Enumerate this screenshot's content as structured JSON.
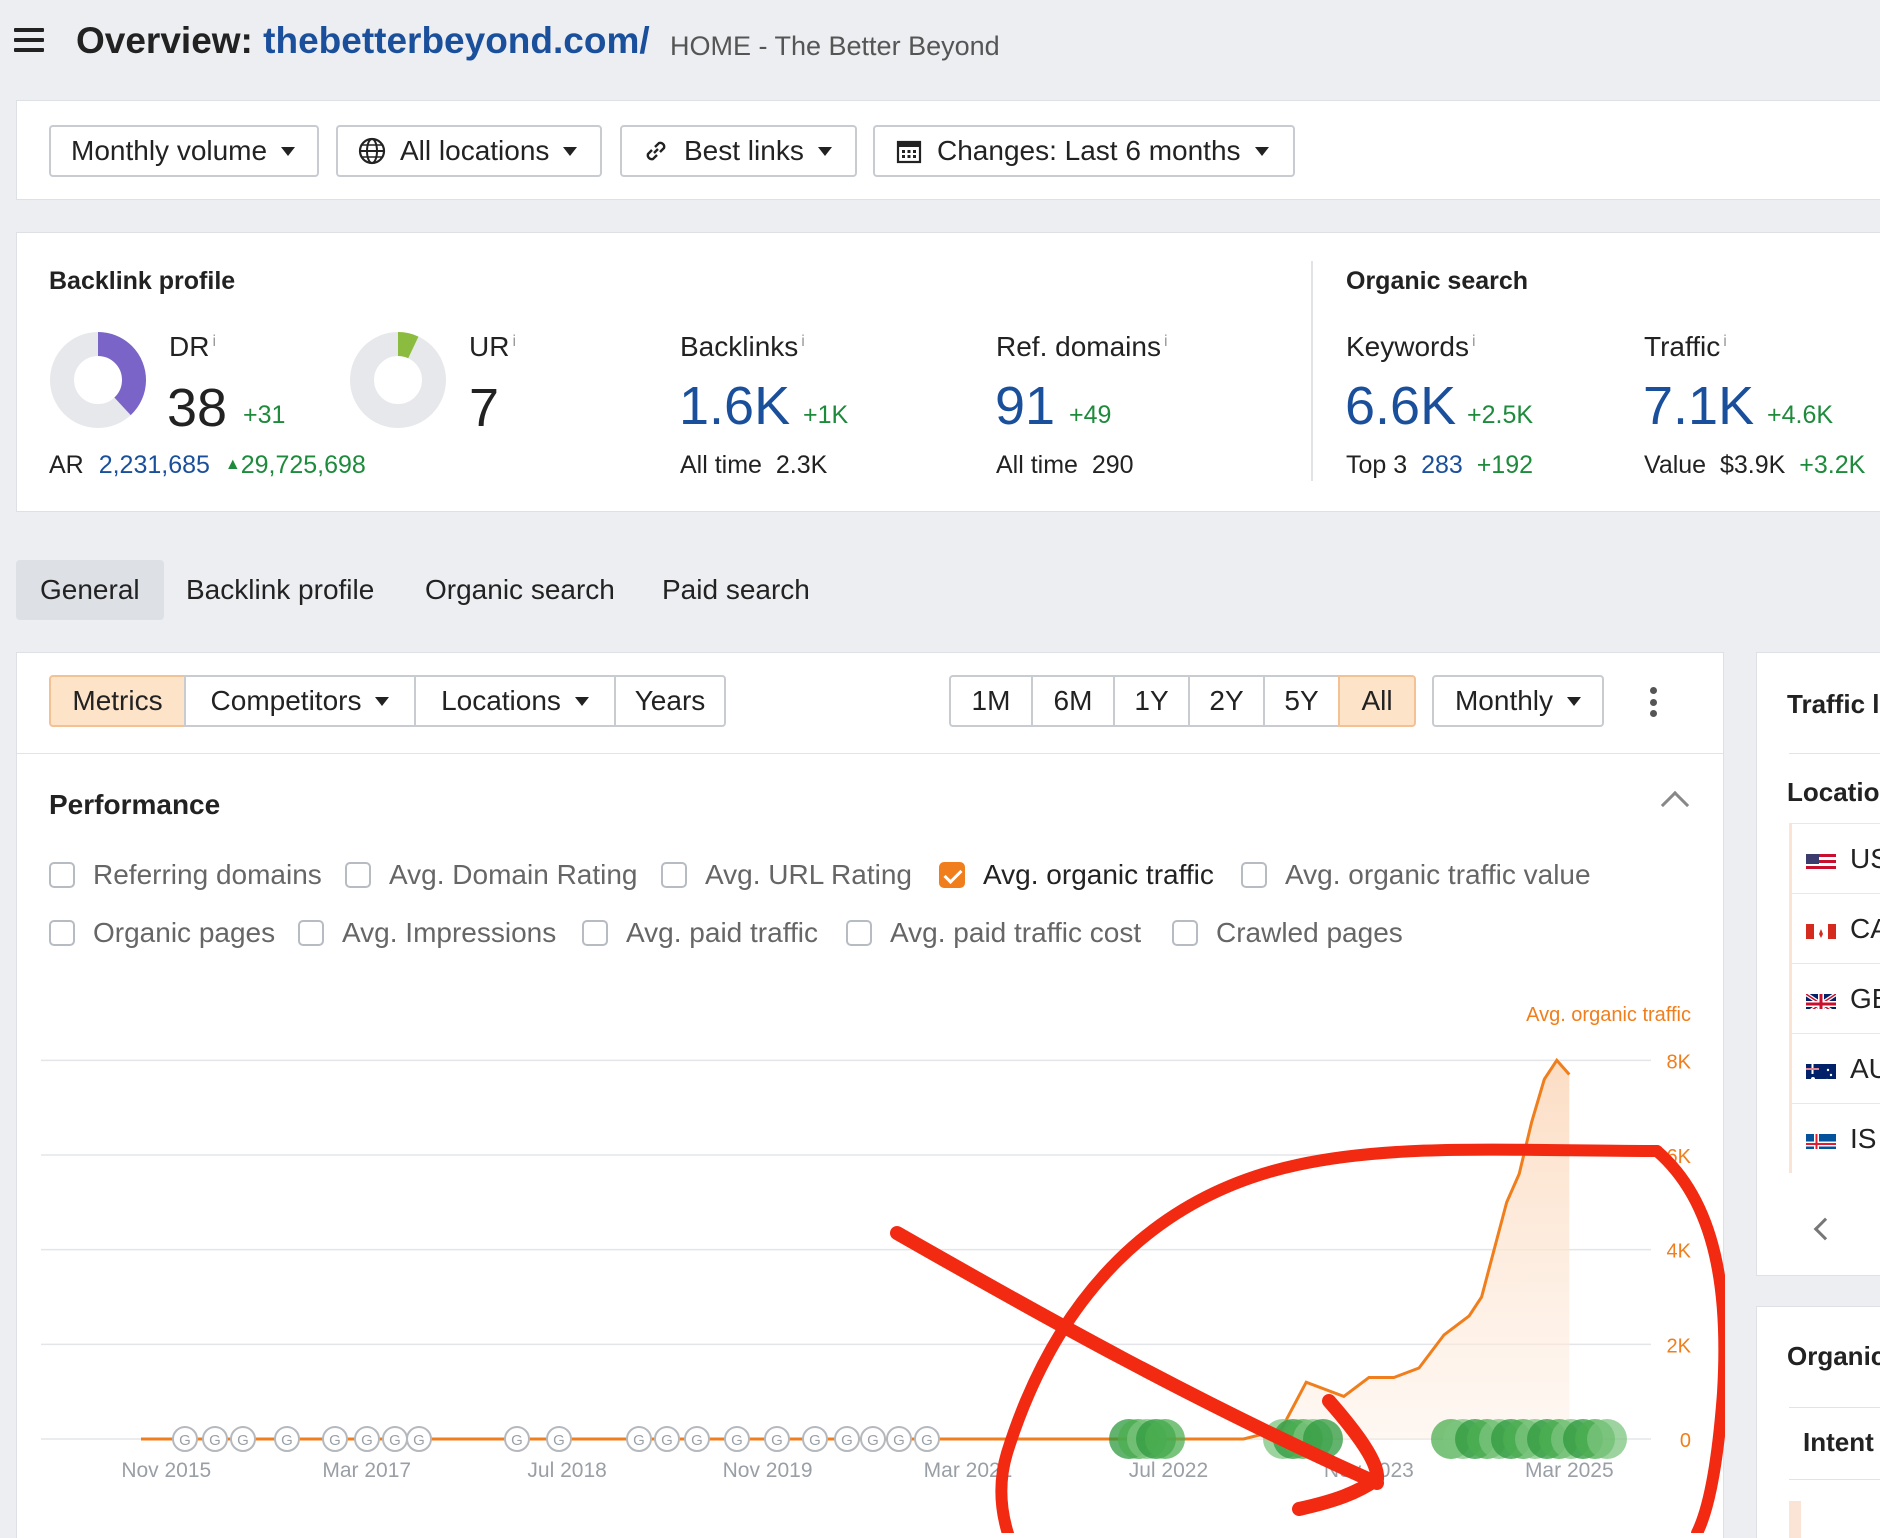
{
  "header": {
    "title_prefix": "Overview:",
    "domain": "thebetterbeyond.com/",
    "subtitle": "HOME - The Better Beyond"
  },
  "filters": {
    "volume": "Monthly volume",
    "locations": "All locations",
    "links": "Best links",
    "changes": "Changes: Last 6 months"
  },
  "backlink_profile": {
    "title": "Backlink profile",
    "dr": {
      "label": "DR",
      "value": "38",
      "delta": "+31",
      "ring_fraction": 0.38
    },
    "ar": {
      "label": "AR",
      "value": "2,231,685",
      "delta": "29,725,698"
    },
    "ur": {
      "label": "UR",
      "value": "7",
      "ring_fraction": 0.07
    },
    "backlinks": {
      "label": "Backlinks",
      "value": "1.6K",
      "delta": "+1K",
      "sub_label": "All time",
      "sub_value": "2.3K"
    },
    "ref_domains": {
      "label": "Ref. domains",
      "value": "91",
      "delta": "+49",
      "sub_label": "All time",
      "sub_value": "290"
    }
  },
  "organic_search": {
    "title": "Organic search",
    "keywords": {
      "label": "Keywords",
      "value": "6.6K",
      "delta": "+2.5K",
      "sub_label": "Top 3",
      "sub_value": "283",
      "sub_delta": "+192"
    },
    "traffic": {
      "label": "Traffic",
      "value": "7.1K",
      "delta": "+4.6K",
      "sub_label": "Value",
      "sub_value": "$3.9K",
      "sub_delta": "+3.2K"
    }
  },
  "tabs": [
    "General",
    "Backlink profile",
    "Organic search",
    "Paid search"
  ],
  "chart_controls": {
    "metrics": "Metrics",
    "competitors": "Competitors",
    "locations": "Locations",
    "years": "Years",
    "ranges": [
      "1M",
      "6M",
      "1Y",
      "2Y",
      "5Y",
      "All"
    ],
    "active_range": "All",
    "interval": "Monthly"
  },
  "performance": {
    "title": "Performance",
    "checkboxes_row1": [
      {
        "label": "Referring domains",
        "checked": false
      },
      {
        "label": "Avg. Domain Rating",
        "checked": false
      },
      {
        "label": "Avg. URL Rating",
        "checked": false
      },
      {
        "label": "Avg. organic traffic",
        "checked": true
      },
      {
        "label": "Avg. organic traffic value",
        "checked": false
      }
    ],
    "checkboxes_row2": [
      {
        "label": "Organic pages",
        "checked": false
      },
      {
        "label": "Avg. Impressions",
        "checked": false
      },
      {
        "label": "Avg. paid traffic",
        "checked": false
      },
      {
        "label": "Avg. paid traffic cost",
        "checked": false
      },
      {
        "label": "Crawled pages",
        "checked": false
      }
    ]
  },
  "chart_data": {
    "type": "area",
    "series": [
      {
        "name": "Avg. organic traffic",
        "x": [
          "Nov 2015",
          "Mar 2017",
          "Jul 2018",
          "Nov 2019",
          "Mar 2021",
          "Jul 2022",
          "Jan 2023",
          "Apr 2023",
          "Jun 2023",
          "Sep 2023",
          "Nov 2023",
          "Jan 2024",
          "Mar 2024",
          "May 2024",
          "Jul 2024",
          "Aug 2024",
          "Sep 2024",
          "Oct 2024",
          "Nov 2024",
          "Dec 2024",
          "Jan 2025",
          "Feb 2025",
          "Mar 2025"
        ],
        "values": [
          0,
          0,
          0,
          0,
          0,
          0,
          0,
          200,
          1200,
          900,
          1300,
          1300,
          1500,
          2200,
          2600,
          3000,
          4000,
          5000,
          5600,
          6700,
          7600,
          8000,
          7700
        ]
      }
    ],
    "x_tick_labels": [
      "Nov 2015",
      "Mar 2017",
      "Jul 2018",
      "Nov 2019",
      "Mar 2021",
      "Jul 2022",
      "Nov 2023",
      "Mar 2025"
    ],
    "y_tick_labels": [
      "0",
      "2K",
      "4K",
      "6K",
      "8K"
    ],
    "ylim": [
      0,
      9000
    ],
    "y_axis_position": "right",
    "y_axis_label": "Avg. organic traffic",
    "grid": true,
    "colors": {
      "line": "#f07e1c",
      "fill": "#fde9d9"
    }
  },
  "right_panel": {
    "traffic_title": "Traffic l",
    "location_header": "Locatio",
    "locations": [
      "US",
      "CA",
      "GB",
      "AU",
      "IS"
    ],
    "organic_title": "Organic",
    "intent_header": "Intent"
  }
}
